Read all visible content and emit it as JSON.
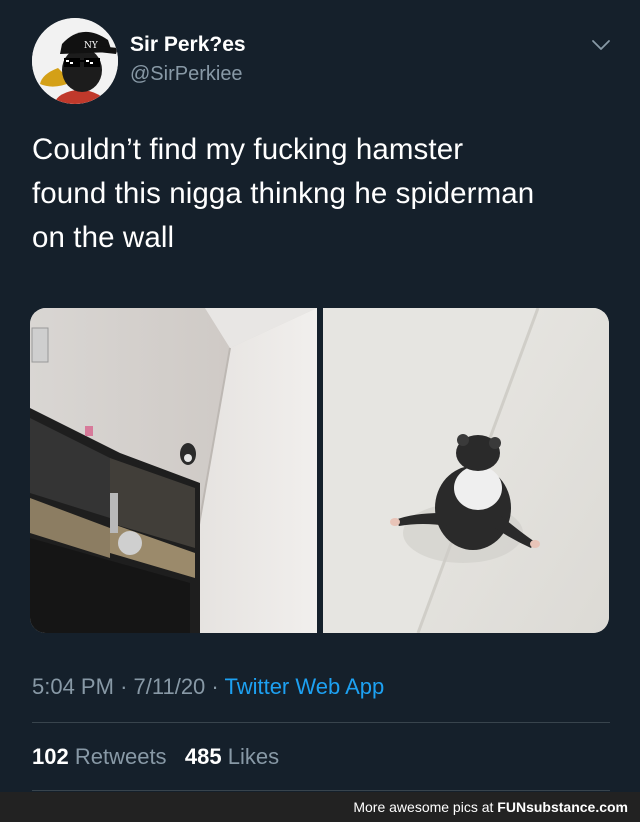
{
  "tweet": {
    "author": {
      "display_name": "Sir Perk?es",
      "handle": "@SirPerkiee",
      "avatar_icon": "duck-sunglasses-avatar"
    },
    "menu_icon": "chevron-down-icon",
    "text_lines": [
      "Couldn’t find my fucking hamster",
      "found this nigga thinkng he spiderman",
      "on the wall"
    ],
    "media": [
      {
        "name": "room-wall-photo",
        "description_icon": "photo"
      },
      {
        "name": "hamster-on-wall-photo",
        "description_icon": "photo"
      }
    ],
    "time": "5:04 PM",
    "date": "7/11/20",
    "separator": "·",
    "source": "Twitter Web App",
    "retweets_count": "102",
    "retweets_label": "Retweets",
    "likes_count": "485",
    "likes_label": "Likes"
  },
  "footer": {
    "prefix": "More awesome pics at",
    "brand": "FUNsubstance.com"
  },
  "colors": {
    "background": "#15202b",
    "secondary_text": "#8899a6",
    "link": "#1da1f2",
    "divider": "#38444d"
  }
}
